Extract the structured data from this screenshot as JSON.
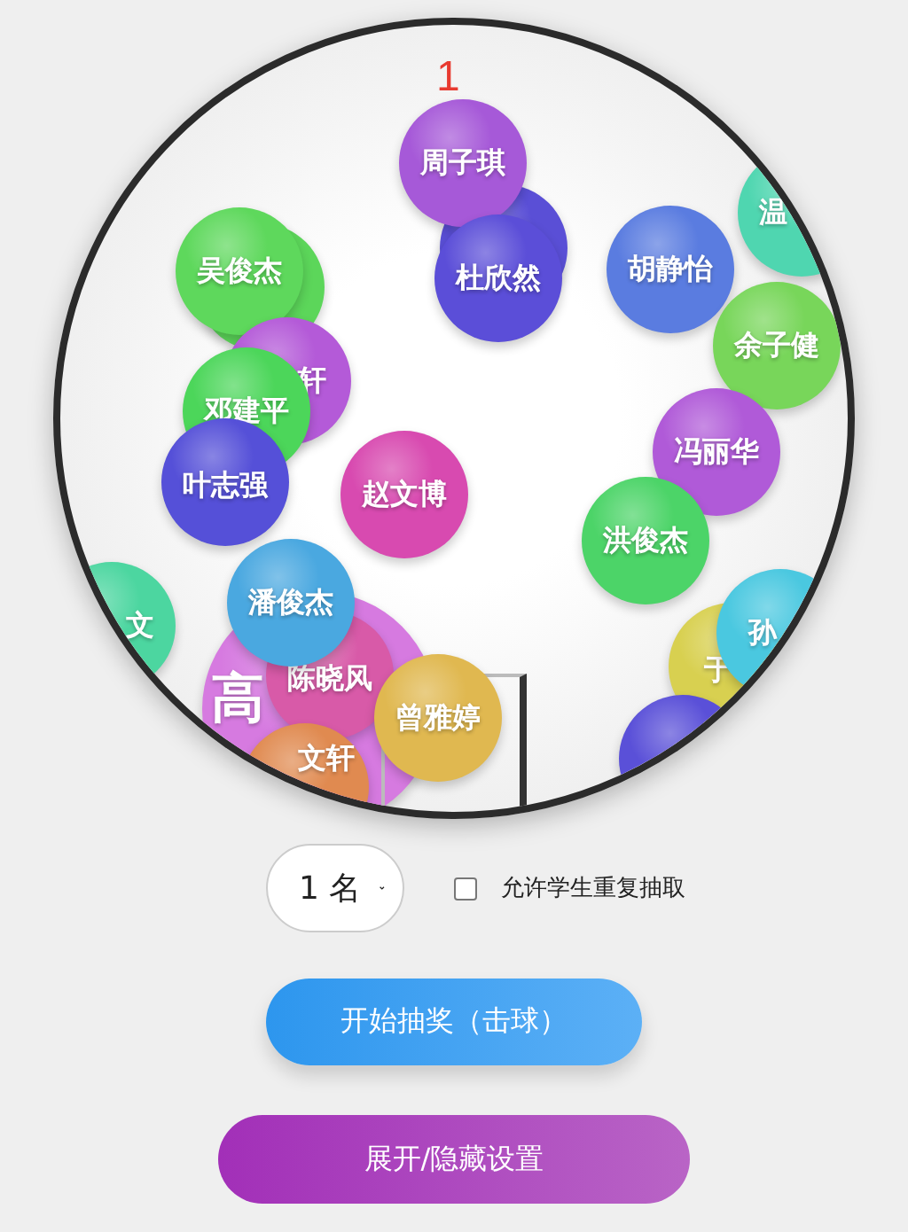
{
  "winner_count": "1",
  "balls": [
    {
      "name": "高",
      "color": "#d67ae0"
    },
    {
      "color": "#5a4fd6"
    },
    {
      "name": "周子琪",
      "color": "#a659d8"
    },
    {
      "name": "杜欣然",
      "color": "#5b4ed8"
    },
    {
      "name": "胡静怡",
      "color": "#5a7ce0"
    },
    {
      "name": "温",
      "color": "#4fd6b0"
    },
    {
      "name": "余子健",
      "color": "#78d65a"
    },
    {
      "color": "#5cd65a"
    },
    {
      "name": "吴俊杰",
      "color": "#5ed85c"
    },
    {
      "name": "轩",
      "color": "#b45ad8"
    },
    {
      "name": "邓建平",
      "color": "#4cd65a"
    },
    {
      "name": "叶志强",
      "color": "#5550d8"
    },
    {
      "name": "赵文博",
      "color": "#d84ab0"
    },
    {
      "name": "冯丽华",
      "color": "#b05ad8"
    },
    {
      "name": "洪俊杰",
      "color": "#4cd468"
    },
    {
      "name": "文",
      "color": "#4cd6a0"
    },
    {
      "name": "陈晓风",
      "color": "#d85aa8"
    },
    {
      "name": "潘俊杰",
      "color": "#4aa8e0"
    },
    {
      "name": "文轩",
      "color": "#e08a50"
    },
    {
      "name": "曾雅婷",
      "color": "#e0b850"
    },
    {
      "name": "于",
      "color": "#d8d050"
    },
    {
      "name": "孙",
      "color": "#4ac8e0"
    },
    {
      "color": "#5a50d8"
    }
  ],
  "count_select": {
    "value": "1 名"
  },
  "repeat_checkbox": {
    "label": "允许学生重复抽取",
    "checked": false
  },
  "buttons": [
    {
      "label": "开始抽奖（击球）",
      "kind": "start"
    },
    {
      "label": "展开/隐藏设置",
      "kind": "settings"
    }
  ]
}
